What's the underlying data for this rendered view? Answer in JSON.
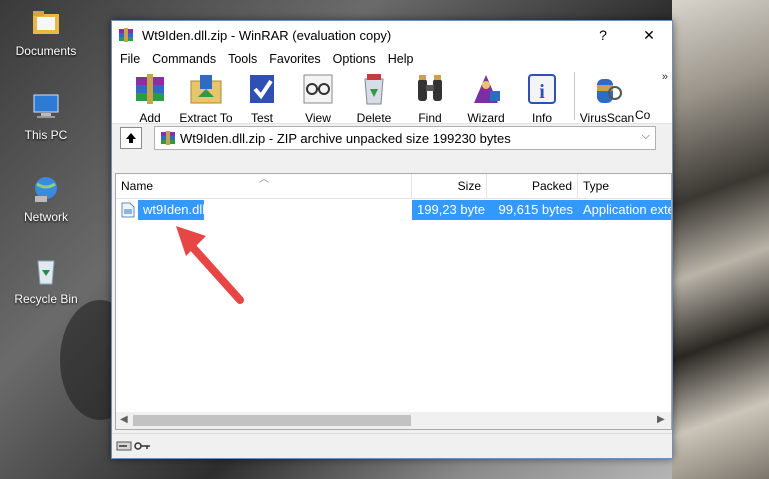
{
  "desktop": {
    "icons": [
      {
        "label": "Documents"
      },
      {
        "label": "This PC"
      },
      {
        "label": "Network"
      },
      {
        "label": "Recycle Bin"
      }
    ]
  },
  "window": {
    "title": "Wt9Iden.dll.zip - WinRAR (evaluation copy)",
    "help_button": "?",
    "close_button": "✕"
  },
  "menu": [
    "File",
    "Commands",
    "Tools",
    "Favorites",
    "Options",
    "Help"
  ],
  "toolbar": {
    "buttons": [
      "Add",
      "Extract To",
      "Test",
      "View",
      "Delete",
      "Find",
      "Wizard",
      "Info",
      "VirusScan",
      "Co"
    ],
    "overflow": "»"
  },
  "address": {
    "text": "Wt9Iden.dll.zip - ZIP archive unpacked size 199230 bytes"
  },
  "columns": [
    "Name",
    "Size",
    "Packed",
    "Type"
  ],
  "files": [
    {
      "name": "wt9Iden.dll",
      "size": "199,23 byte",
      "packed": "99,615 bytes",
      "type": "Application exte"
    }
  ],
  "colors": {
    "selection": "#3399ff",
    "arrow": "#e84545",
    "border": "#6e8fb9"
  }
}
